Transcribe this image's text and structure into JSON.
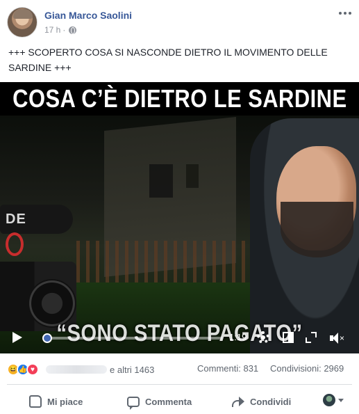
{
  "post": {
    "author": "Gian Marco Saolini",
    "timestamp": "17 h",
    "privacy_separator": "·",
    "text": "+++ SCOPERTO COSA SI NASCONDE DIETRO IL MOVIMENTO DELLE SARDINE +++",
    "icons": {
      "privacy": "globe-icon",
      "menu": "more-icon"
    }
  },
  "video": {
    "title_overlay": "COSA C’È DIETRO LE SARDINE",
    "subtitle_overlay": "“SONO STATO PAGATO”",
    "mic_brand": "DE",
    "time": "1:19",
    "progress": 0.02,
    "icons": [
      "play-icon",
      "gear-icon",
      "screen-icon",
      "fullscreen-icon",
      "mute-icon"
    ]
  },
  "stats": {
    "reaction_icons": [
      "haha-icon",
      "like-icon",
      "love-icon"
    ],
    "others": "e altri 1463",
    "comments": "Commenti: 831",
    "shares": "Condivisioni: 2969"
  },
  "actions": {
    "like": "Mi piace",
    "comment": "Commenta",
    "share": "Condividi"
  },
  "colors": {
    "author_link": "#385898",
    "like_blue": "#1877f2",
    "love_red": "#f33e58",
    "haha_yellow": "#f7b125",
    "muted_text": "#606770"
  }
}
